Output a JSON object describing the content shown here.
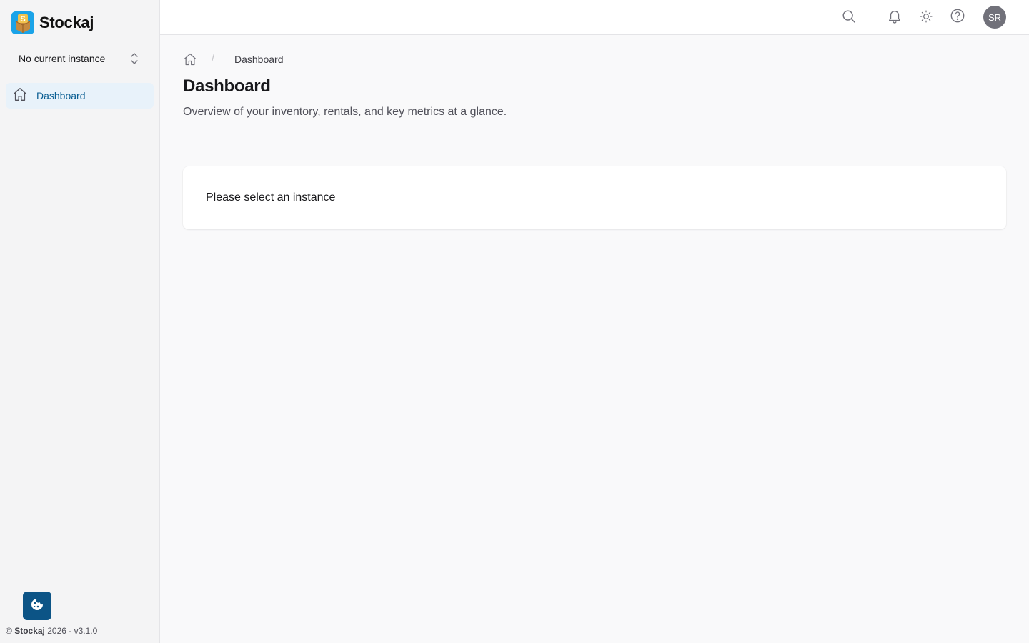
{
  "brand": {
    "name": "Stockaj",
    "logo_letter": "S"
  },
  "sidebar": {
    "instance_select": {
      "label": "No current instance"
    },
    "nav": [
      {
        "label": "Dashboard",
        "icon": "home-icon",
        "active": true
      }
    ]
  },
  "topbar": {
    "icons": [
      "search-icon",
      "bell-icon",
      "sun-icon",
      "help-icon"
    ],
    "avatar_initials": "SR"
  },
  "main": {
    "breadcrumb": {
      "current": "Dashboard"
    },
    "title": "Dashboard",
    "subtitle": "Overview of your inventory, rentals, and key metrics at a glance.",
    "card_message": "Please select an instance"
  },
  "footer": {
    "copyright": "©",
    "brand": "Stockaj",
    "text": "2026 - v3.1.0"
  },
  "colors": {
    "accent": "#0b5f93",
    "active_bg": "#e8f2fa",
    "cookie_button": "#0c5486",
    "logo_bg": "#1aa3e8"
  }
}
